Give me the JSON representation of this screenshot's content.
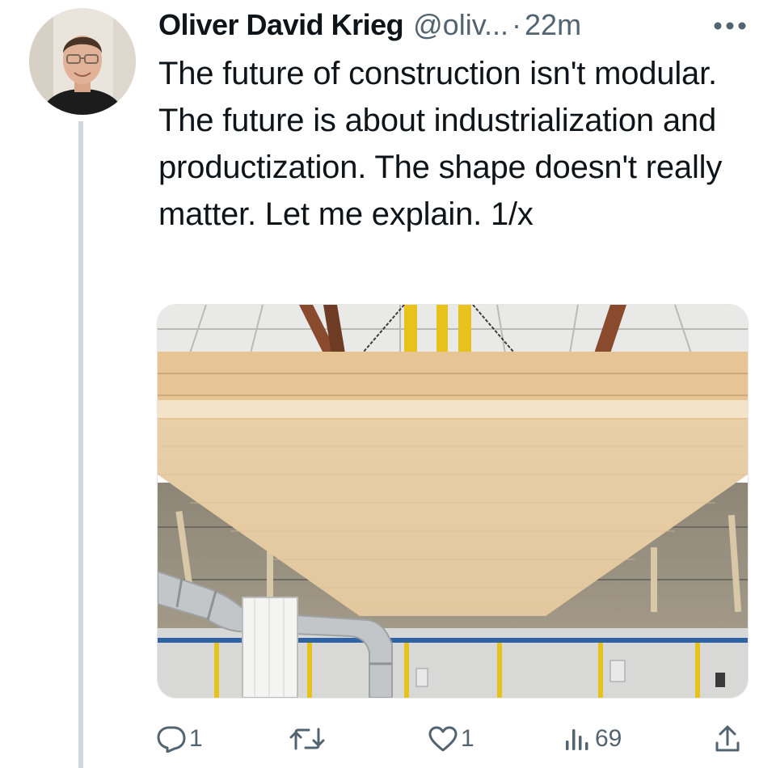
{
  "tweet": {
    "author_name": "Oliver David Krieg",
    "author_handle": "@oliv...",
    "separator": "·",
    "timestamp": "22m",
    "text": "The future of construction isn't modular. The future is about industrialization and productization. The shape doesn't really matter. Let me explain. 1/x"
  },
  "media": {
    "description_icon": "photo"
  },
  "actions": {
    "reply_count": "1",
    "retweet_count": "",
    "like_count": "1",
    "views_count": "69"
  },
  "icons": {
    "more": "more-horizontal-icon",
    "reply": "reply-icon",
    "retweet": "retweet-icon",
    "like": "heart-icon",
    "views": "analytics-icon",
    "share": "share-icon"
  },
  "colors": {
    "text": "#0f1419",
    "secondary": "#536471",
    "thread_line": "#cfd9de"
  }
}
